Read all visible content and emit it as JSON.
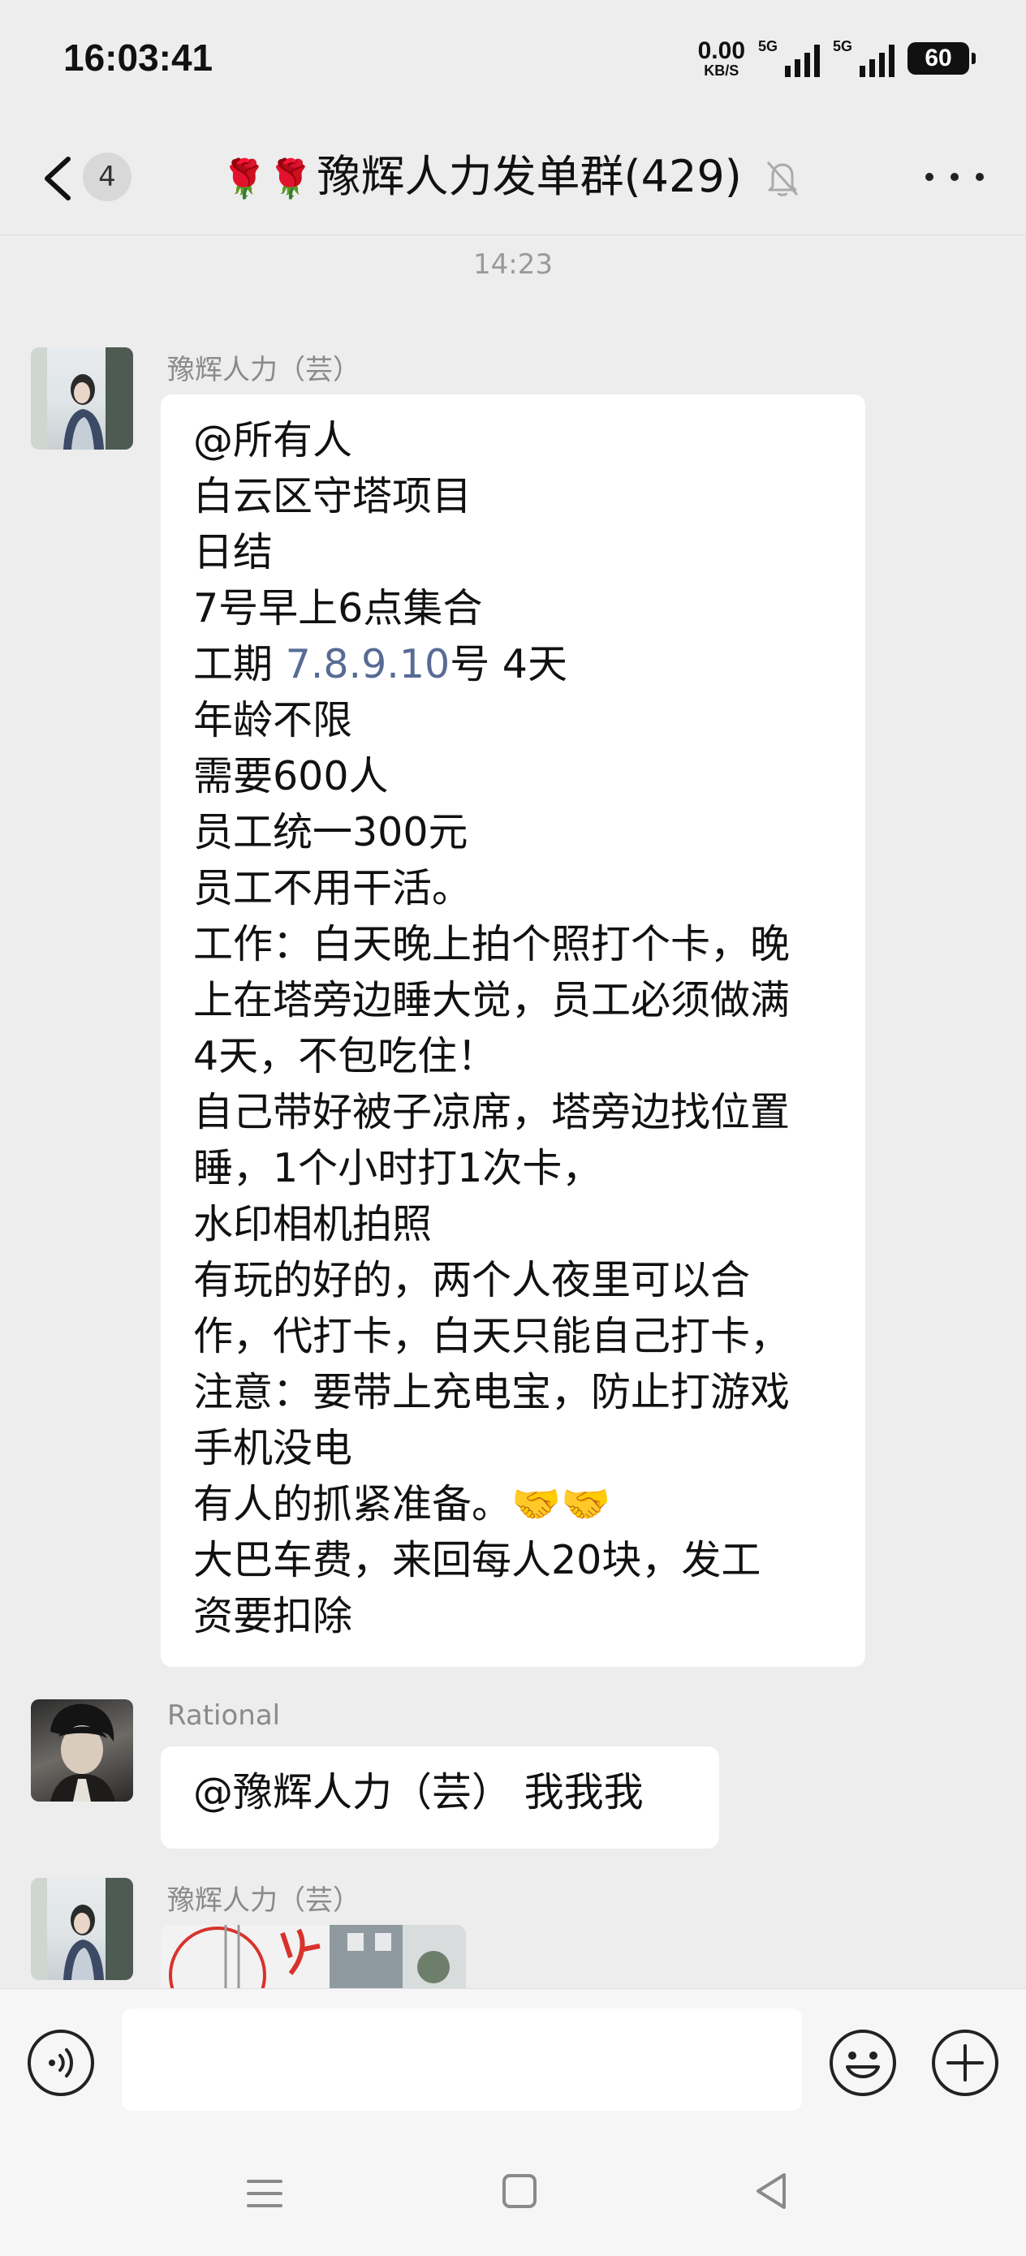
{
  "status_bar": {
    "time": "16:03:41",
    "net_speed_value": "0.00",
    "net_speed_unit": "KB/S",
    "signal1_label": "5G",
    "signal2_label": "5G",
    "battery": "60"
  },
  "header": {
    "back_count": "4",
    "title_prefix": "🌹🌹",
    "title": "豫辉人力发单群(429)",
    "icons": [
      "back-arrow-icon",
      "mute-bell-icon",
      "more-icon"
    ]
  },
  "chat": {
    "timestamp": "14:23",
    "messages": [
      {
        "sender": "豫辉人力（芸）",
        "lines": [
          "@所有人",
          "白云区守塔项目",
          "日结",
          "7号早上6点集合",
          "工期 ",
          "年龄不限",
          "需要600人",
          "员工统一300元",
          "员工不用干活。",
          "工作：白天晚上拍个照打个卡，晚",
          "上在塔旁边睡大觉，员工必须做满",
          "4天，不包吃住！",
          "自己带好被子凉席，塔旁边找位置",
          "睡，1个小时打1次卡，",
          "水印相机拍照",
          "有玩的好的，两个人夜里可以合",
          "作，代打卡，白天只能自己打卡，",
          "注意：要带上充电宝，防止打游戏",
          "手机没电",
          "有人的抓紧准备。🤝🤝",
          "大巴车费，来回每人20块，发工",
          "资要扣除"
        ],
        "link_text": "7.8.9.10",
        "after_link": "号 4天"
      },
      {
        "sender": "Rational",
        "text": "@豫辉人力（芸） 我我我"
      },
      {
        "sender": "豫辉人力（芸）",
        "type": "image"
      }
    ]
  },
  "input_bar": {
    "placeholder": "",
    "icons": [
      "voice-icon",
      "emoji-icon",
      "plus-icon"
    ]
  },
  "nav_bar": {
    "icons": [
      "menu-icon",
      "home-icon",
      "back-icon"
    ]
  }
}
